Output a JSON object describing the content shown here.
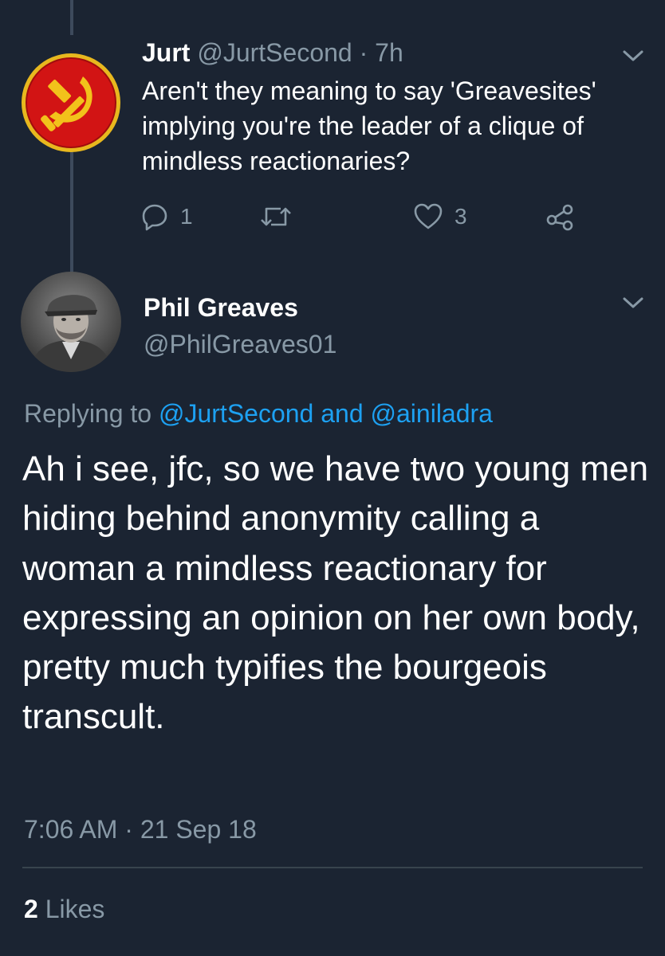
{
  "reply_tweet": {
    "author_name": "Jurt",
    "author_handle": "@JurtSecond",
    "separator": "·",
    "age": "7h",
    "text": "Aren't they meaning to say 'Greavesites' implying you're the leader of a clique of mindless reactionaries?",
    "avatar_icon": "hammer-and-sickle-icon",
    "actions": {
      "reply_count": "1",
      "retweet_count": "",
      "like_count": "3"
    }
  },
  "main_tweet": {
    "author_name": "Phil Greaves",
    "author_handle": "@PhilGreaves01",
    "replying_prefix": "Replying to",
    "replying_user_1": "@JurtSecond",
    "replying_and": "and",
    "replying_user_2": "@ainiladra",
    "text": "Ah i see, jfc, so we have two young men hiding behind anonymity calling a woman a mindless reactionary for expressing an opinion on her own body, pretty much typifies the bourgeois transcult.",
    "time": "7:06 AM",
    "separator": "·",
    "date": "21 Sep 18",
    "likes_count": "2",
    "likes_label": "Likes"
  },
  "colors": {
    "background": "#1b2432",
    "muted_text": "#8899a6",
    "link": "#1da1f2",
    "thread_line": "#3d4a5c",
    "divider": "#38444d"
  }
}
